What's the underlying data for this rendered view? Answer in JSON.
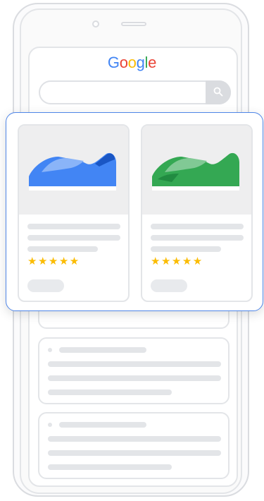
{
  "logo": {
    "letters": [
      "G",
      "o",
      "o",
      "g",
      "l",
      "e"
    ],
    "colors": [
      "#4285F4",
      "#EA4335",
      "#FBBC05",
      "#4285F4",
      "#34A853",
      "#EA4335"
    ]
  },
  "search": {
    "icon": "search-icon",
    "placeholder": ""
  },
  "products": [
    {
      "shoe_color": "#4285F4",
      "shoe_color_light": "#8AB4F8",
      "shoe_color_dark": "#1A56C4",
      "rating": 5,
      "stars": "★★★★★"
    },
    {
      "shoe_color": "#34A853",
      "shoe_color_light": "#81C995",
      "shoe_color_dark": "#137333",
      "rating": 5,
      "stars": "★★★★★"
    }
  ],
  "colors": {
    "highlight_border": "#4F86E8",
    "star": "#FBBC04",
    "placeholder_gray": "#E3E5E8"
  }
}
